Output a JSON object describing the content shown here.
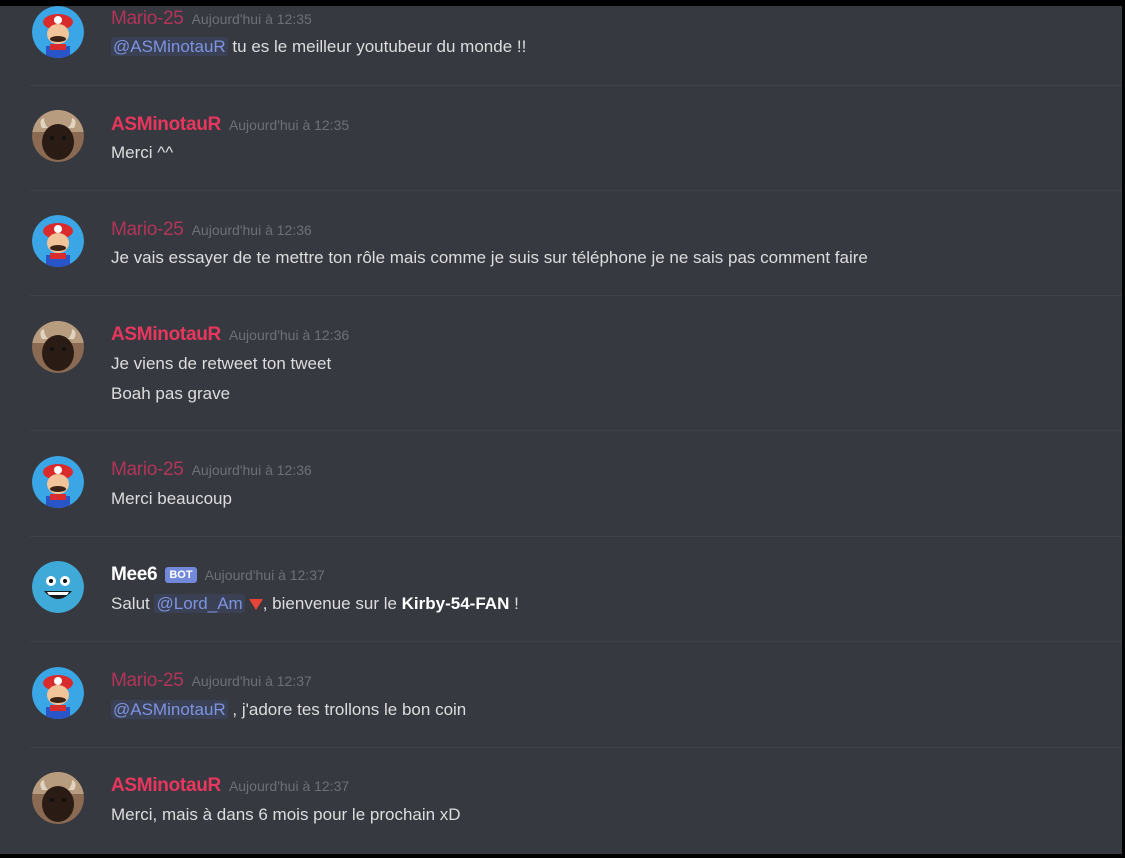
{
  "users": {
    "mario": "Mario-25",
    "asm": "ASMinotauR",
    "mee6": "Mee6"
  },
  "bot_badge": "BOT",
  "messages": [
    {
      "author": "Mario-25",
      "timestamp": "Aujourd'hui à 12:35",
      "mention": "@ASMinotauR",
      "text": " tu es le meilleur youtubeur du monde !!"
    },
    {
      "author": "ASMinotauR",
      "timestamp": "Aujourd'hui à 12:35",
      "text": "Merci ^^"
    },
    {
      "author": "Mario-25",
      "timestamp": "Aujourd'hui à 12:36",
      "text": "Je vais essayer de te mettre ton rôle mais comme je suis sur téléphone je ne sais pas comment faire"
    },
    {
      "author": "ASMinotauR",
      "timestamp": "Aujourd'hui à 12:36",
      "lines": [
        "Je viens de retweet ton tweet",
        "Boah pas grave"
      ]
    },
    {
      "author": "Mario-25",
      "timestamp": "Aujourd'hui à 12:36",
      "text": "Merci beaucoup"
    },
    {
      "author": "Mee6",
      "timestamp": "Aujourd'hui à 12:37",
      "prefix": "Salut ",
      "mention": "@Lord_Am",
      "middle": ", bienvenue sur le ",
      "server": "Kirby-54-FAN",
      "suffix": " !"
    },
    {
      "author": "Mario-25",
      "timestamp": "Aujourd'hui à 12:37",
      "mention": "@ASMinotauR",
      "text": " , j'adore tes trollons le bon coin"
    },
    {
      "author": "ASMinotauR",
      "timestamp": "Aujourd'hui à 12:37",
      "text": "Merci, mais à dans 6 mois pour le prochain xD"
    }
  ],
  "colors": {
    "background": "#36393f",
    "mario_name": "#c9345f",
    "asm_name": "#e8365e",
    "mention": "#7d93df",
    "bot_badge": "#7289da",
    "text": "#dcddde",
    "timestamp": "#6d7078"
  },
  "icons": {
    "mario_avatar": "mario-avatar-icon",
    "asm_avatar": "minotaur-avatar-icon",
    "mee6_avatar": "mee6-avatar-icon"
  }
}
